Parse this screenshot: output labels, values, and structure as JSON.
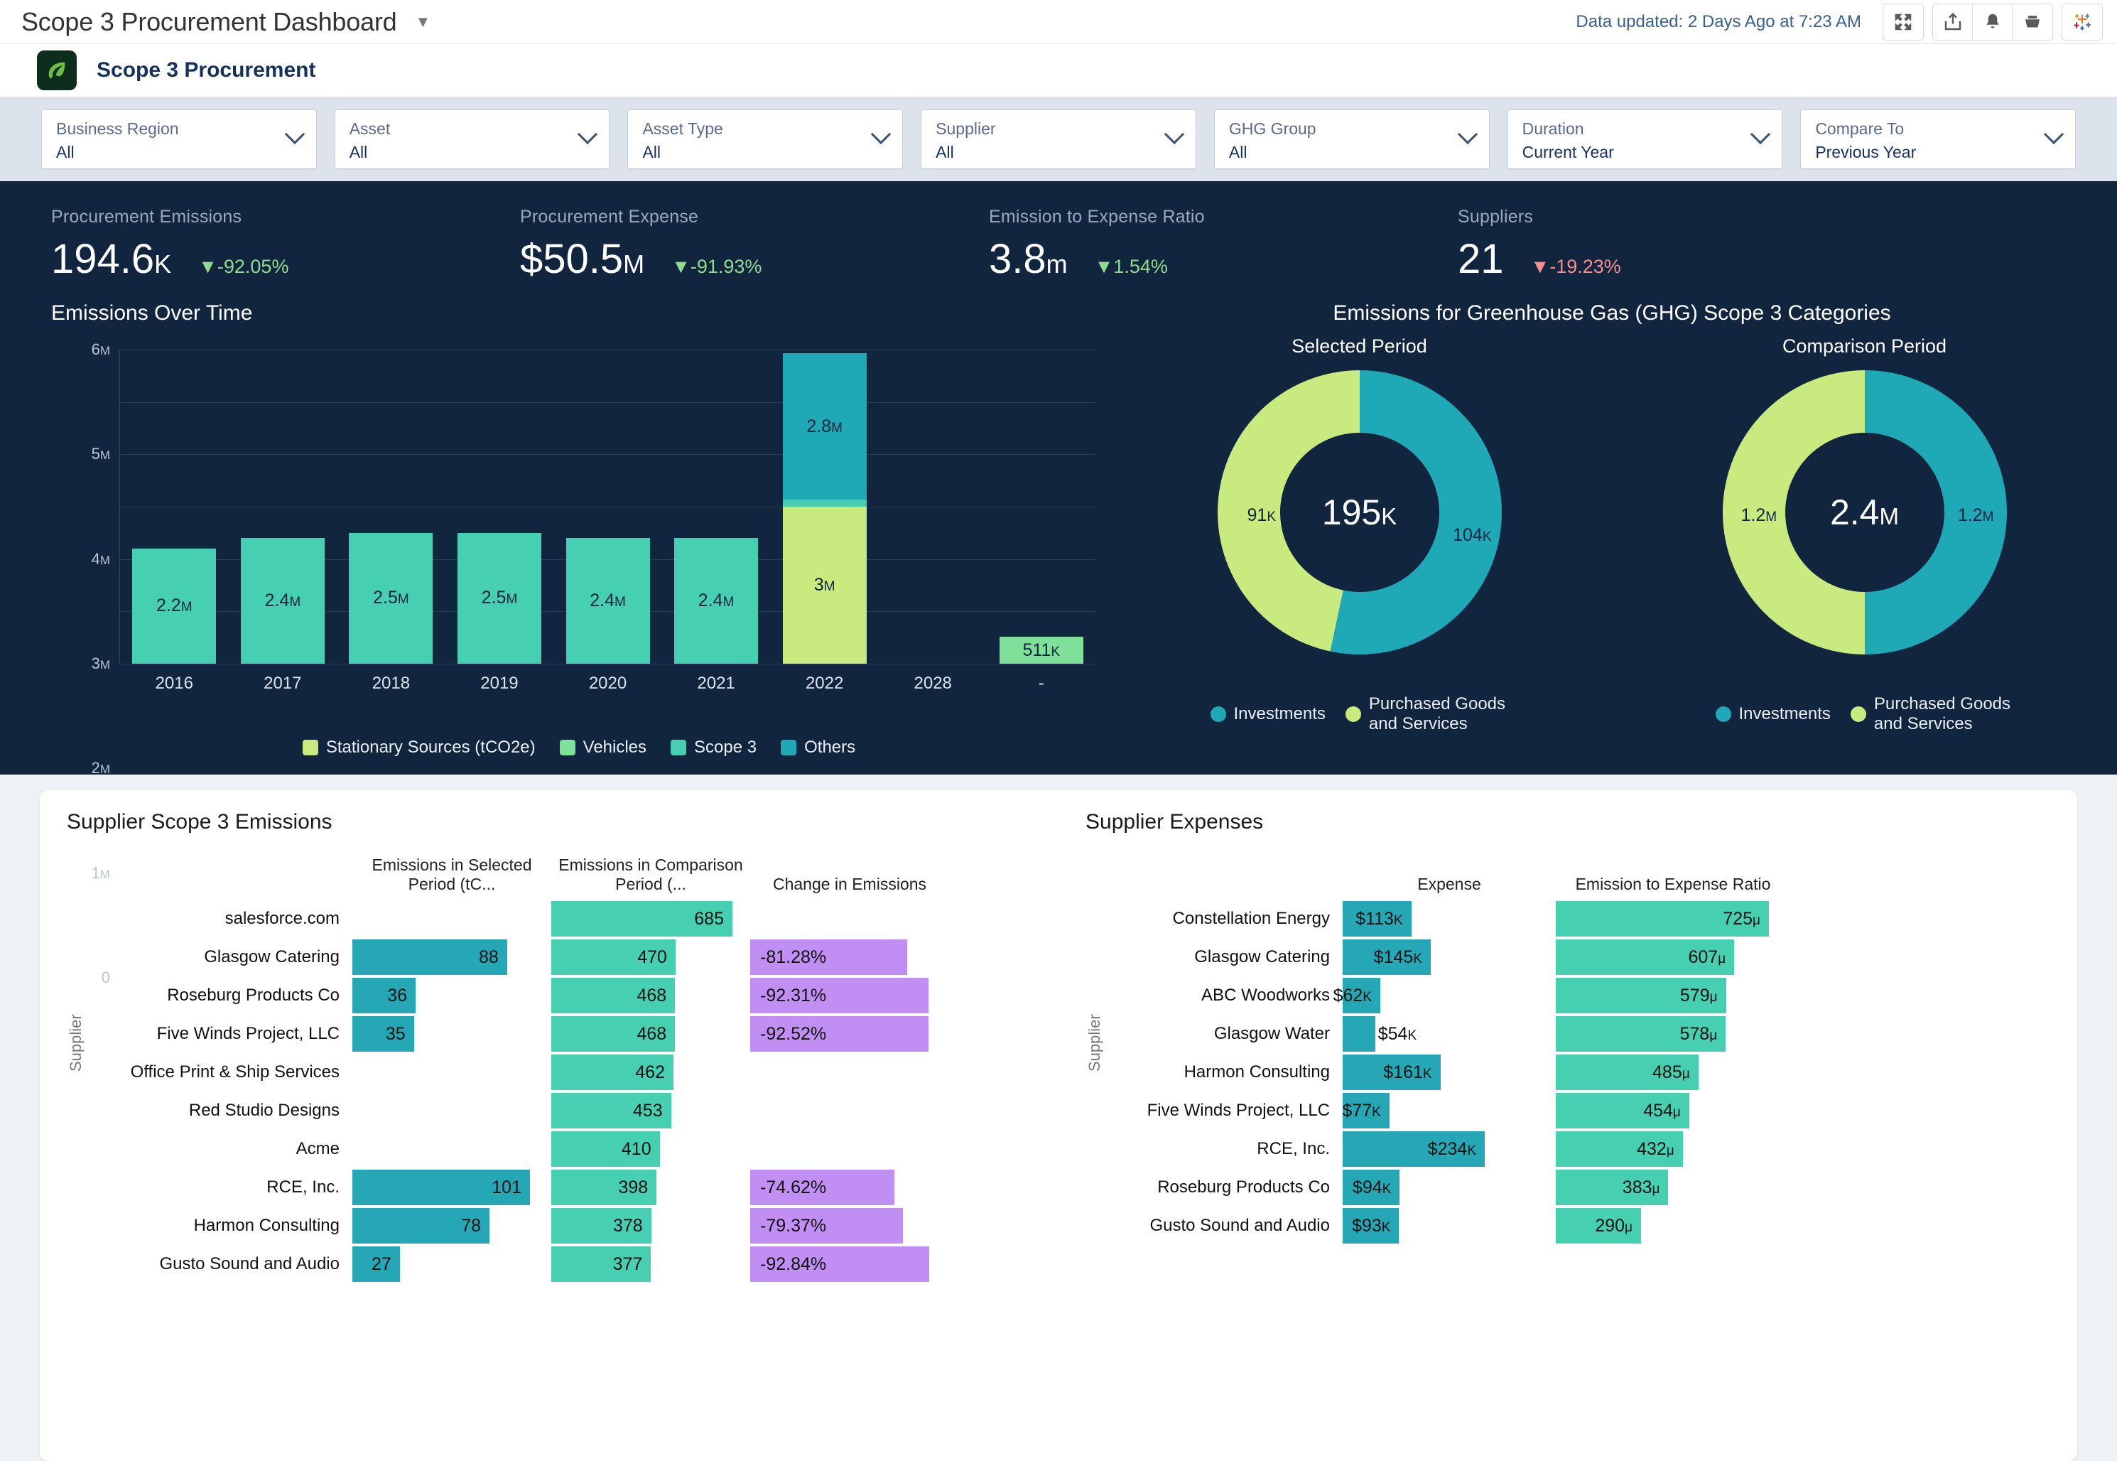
{
  "topbar": {
    "workbook_title": "Scope 3 Procurement Dashboard",
    "caret_icon": "chevron-down-icon",
    "data_updated": "Data updated: 2 Days Ago at 7:23 AM",
    "icons": [
      "fullscreen-icon",
      "share-icon",
      "alert-bell-icon",
      "download-icon",
      "tableau-sparkle-icon"
    ]
  },
  "dashboard": {
    "title": "Scope 3 Procurement",
    "logo_icon": "leaf-icon"
  },
  "filters": [
    {
      "label": "Business Region",
      "value": "All",
      "icon": "chevron-down-icon"
    },
    {
      "label": "Asset",
      "value": "All",
      "icon": "chevron-down-icon"
    },
    {
      "label": "Asset Type",
      "value": "All",
      "icon": "chevron-down-icon"
    },
    {
      "label": "Supplier",
      "value": "All",
      "icon": "chevron-down-icon"
    },
    {
      "label": "GHG Group",
      "value": "All",
      "icon": "chevron-down-icon"
    },
    {
      "label": "Duration",
      "value": "Current Year",
      "icon": "chevron-down-icon"
    },
    {
      "label": "Compare To",
      "value": "Previous Year",
      "icon": "chevron-down-icon"
    }
  ],
  "kpis": [
    {
      "label": "Procurement Emissions",
      "value": "194.6",
      "suffix": "K",
      "delta": "▼-92.05%",
      "tone": "down-good"
    },
    {
      "label": "Procurement Expense",
      "value": "$50.5",
      "suffix": "M",
      "delta": "▼-91.93%",
      "tone": "down-good"
    },
    {
      "label": "Emission to Expense Ratio",
      "value": "3.8",
      "suffix": "m",
      "delta": "▼1.54%",
      "tone": "down-good"
    },
    {
      "label": "Suppliers",
      "value": "21",
      "suffix": "",
      "delta": "▼-19.23%",
      "tone": "down-bad"
    }
  ],
  "colors": {
    "dark_bg": "#11253f",
    "scope3_teal": "#46cfb0",
    "others_teal": "#1fa8b6",
    "stationary_green": "#c9ea7f",
    "vehicles_green": "#7fe09a",
    "purple": "#c18ef4",
    "bar_teal_dark": "#25a7b5",
    "delta_good": "#8fdd8c",
    "delta_bad": "#f98d8d"
  },
  "chart_data": [
    {
      "type": "bar",
      "title": "Emissions Over Time",
      "stacked": true,
      "xlabel": "",
      "ylabel": "",
      "ylim": [
        0,
        6000000
      ],
      "yticks": [
        "0",
        "1M",
        "2M",
        "3M",
        "4M",
        "5M",
        "6M"
      ],
      "grid": true,
      "categories": [
        "2016",
        "2017",
        "2018",
        "2019",
        "2020",
        "2021",
        "2022",
        "2028",
        "-"
      ],
      "series": [
        {
          "name": "Stationary Sources (tCO2e)",
          "color": "#c9ea7f",
          "values": [
            0,
            0,
            0,
            0,
            0,
            0,
            3000000,
            0,
            0
          ],
          "labels": [
            "",
            "",
            "",
            "",
            "",
            "",
            "3M",
            "",
            ""
          ]
        },
        {
          "name": "Vehicles",
          "color": "#7fe09a",
          "values": [
            0,
            0,
            0,
            0,
            0,
            0,
            0,
            0,
            511000
          ],
          "labels": [
            "",
            "",
            "",
            "",
            "",
            "",
            "",
            "",
            "511K"
          ]
        },
        {
          "name": "Scope 3",
          "color": "#46cfb0",
          "values": [
            2200000,
            2400000,
            2500000,
            2500000,
            2400000,
            2400000,
            130000,
            0,
            0
          ],
          "labels": [
            "2.2M",
            "2.4M",
            "2.5M",
            "2.5M",
            "2.4M",
            "2.4M",
            "",
            "",
            ""
          ]
        },
        {
          "name": "Others",
          "color": "#1fa8b6",
          "values": [
            0,
            0,
            0,
            0,
            0,
            0,
            2800000,
            0,
            0
          ],
          "labels": [
            "",
            "",
            "",
            "",
            "",
            "",
            "2.8M",
            "",
            ""
          ]
        }
      ],
      "legend": [
        "Stationary Sources (tCO2e)",
        "Vehicles",
        "Scope 3",
        "Others"
      ],
      "legend_position": "bottom"
    },
    {
      "type": "pie",
      "title": "Emissions for Greenhouse Gas (GHG) Scope 3 Categories",
      "subtitle": "Selected Period",
      "center_value": "195",
      "center_suffix": "K",
      "slices": [
        {
          "name": "Investments",
          "label": "104K",
          "value": 104,
          "color": "#1fa8b6"
        },
        {
          "name": "Purchased Goods and Services",
          "label": "91K",
          "value": 91,
          "color": "#c9ea7f"
        }
      ],
      "legend": [
        "Investments",
        "Purchased Goods and Services"
      ],
      "legend_position": "bottom"
    },
    {
      "type": "pie",
      "title": "",
      "subtitle": "Comparison Period",
      "center_value": "2.4",
      "center_suffix": "M",
      "slices": [
        {
          "name": "Investments",
          "label": "1.2M",
          "value": 1.2,
          "color": "#1fa8b6"
        },
        {
          "name": "Purchased Goods and Services",
          "label": "1.2M",
          "value": 1.2,
          "color": "#c9ea7f"
        }
      ],
      "legend": [
        "Investments",
        "Purchased Goods and Services"
      ],
      "legend_position": "bottom"
    },
    {
      "type": "table",
      "title": "Supplier Scope 3 Emissions",
      "axis_label": "Supplier",
      "columns": [
        "Emissions in Selected Period (tC...",
        "Emissions in Comparison Period (...",
        "Change in Emissions"
      ],
      "rows": [
        {
          "supplier": "salesforce.com",
          "selected": null,
          "selected_label": "",
          "comparison": 685,
          "comparison_label": "685",
          "change": null,
          "change_label": ""
        },
        {
          "supplier": "Glasgow Catering",
          "selected": 88,
          "selected_label": "88",
          "comparison": 470,
          "comparison_label": "470",
          "change": -81.28,
          "change_label": "-81.28%"
        },
        {
          "supplier": "Roseburg Products Co",
          "selected": 36,
          "selected_label": "36",
          "comparison": 468,
          "comparison_label": "468",
          "change": -92.31,
          "change_label": "-92.31%"
        },
        {
          "supplier": "Five Winds Project, LLC",
          "selected": 35,
          "selected_label": "35",
          "comparison": 468,
          "comparison_label": "468",
          "change": -92.52,
          "change_label": "-92.52%"
        },
        {
          "supplier": "Office Print & Ship Services",
          "selected": null,
          "selected_label": "",
          "comparison": 462,
          "comparison_label": "462",
          "change": null,
          "change_label": ""
        },
        {
          "supplier": "Red Studio Designs",
          "selected": null,
          "selected_label": "",
          "comparison": 453,
          "comparison_label": "453",
          "change": null,
          "change_label": ""
        },
        {
          "supplier": "Acme",
          "selected": null,
          "selected_label": "",
          "comparison": 410,
          "comparison_label": "410",
          "change": null,
          "change_label": ""
        },
        {
          "supplier": "RCE, Inc.",
          "selected": 101,
          "selected_label": "101",
          "comparison": 398,
          "comparison_label": "398",
          "change": -74.62,
          "change_label": "-74.62%"
        },
        {
          "supplier": "Harmon Consulting",
          "selected": 78,
          "selected_label": "78",
          "comparison": 378,
          "comparison_label": "378",
          "change": -79.37,
          "change_label": "-79.37%"
        },
        {
          "supplier": "Gusto Sound and Audio",
          "selected": 27,
          "selected_label": "27",
          "comparison": 377,
          "comparison_label": "377",
          "change": -92.84,
          "change_label": "-92.84%"
        }
      ]
    },
    {
      "type": "table",
      "title": "Supplier Expenses",
      "axis_label": "Supplier",
      "columns": [
        "Expense",
        "Emission to Expense Ratio"
      ],
      "rows": [
        {
          "supplier": "Constellation Energy",
          "expense": 113,
          "expense_label": "$113K",
          "ratio": 725,
          "ratio_label": "725μ"
        },
        {
          "supplier": "Glasgow Catering",
          "expense": 145,
          "expense_label": "$145K",
          "ratio": 607,
          "ratio_label": "607μ"
        },
        {
          "supplier": "ABC Woodworks",
          "expense": 62,
          "expense_label": "$62K",
          "ratio": 579,
          "ratio_label": "579μ"
        },
        {
          "supplier": "Glasgow Water",
          "expense": 54,
          "expense_label": "$54K",
          "ratio": 578,
          "ratio_label": "578μ"
        },
        {
          "supplier": "Harmon Consulting",
          "expense": 161,
          "expense_label": "$161K",
          "ratio": 485,
          "ratio_label": "485μ"
        },
        {
          "supplier": "Five Winds Project, LLC",
          "expense": 77,
          "expense_label": "$77K",
          "ratio": 454,
          "ratio_label": "454μ"
        },
        {
          "supplier": "RCE, Inc.",
          "expense": 234,
          "expense_label": "$234K",
          "ratio": 432,
          "ratio_label": "432μ"
        },
        {
          "supplier": "Roseburg Products Co",
          "expense": 94,
          "expense_label": "$94K",
          "ratio": 383,
          "ratio_label": "383μ"
        },
        {
          "supplier": "Gusto Sound and Audio",
          "expense": 93,
          "expense_label": "$93K",
          "ratio": 290,
          "ratio_label": "290μ"
        }
      ]
    }
  ]
}
